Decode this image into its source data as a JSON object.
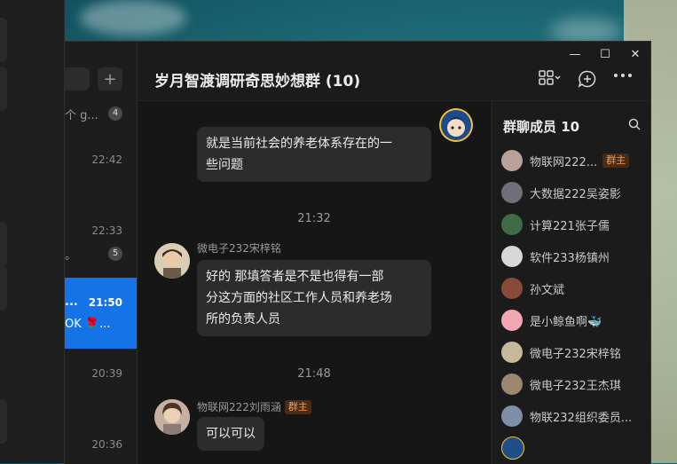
{
  "conversation_list": {
    "add_label": "+",
    "items": [
      {
        "time": "",
        "snippet": "个 g...",
        "badge": "4"
      },
      {
        "time": "22:42",
        "snippet": "",
        "badge": ""
      },
      {
        "time": "22:33",
        "snippet": "。",
        "badge": "5"
      },
      {
        "time": "21:50",
        "snippet": "OK 🌹...",
        "prefix": "...",
        "badge": ""
      },
      {
        "time": "20:39",
        "snippet": "",
        "badge": ""
      },
      {
        "time": "20:36",
        "snippet": "",
        "badge": ""
      }
    ]
  },
  "window_controls": {
    "minimize": "—",
    "maximize": "☐",
    "close": "✕"
  },
  "chat": {
    "title": "岁月智渡调研奇思妙想群 (10)",
    "messages": [
      {
        "id": "m1",
        "own": true,
        "text_lines": [
          "就是当前社会的养老体系存在的一",
          "些问题"
        ]
      },
      {
        "id": "t1",
        "timestamp": "21:32"
      },
      {
        "id": "m2",
        "sender": "微电子232宋梓铭",
        "text_lines": [
          "好的 那填答者是不是也得有一部",
          "分这方面的社区工作人员和养老场",
          "所的负责人员"
        ]
      },
      {
        "id": "t2",
        "timestamp": "21:48"
      },
      {
        "id": "m3",
        "sender": "物联网222刘雨涵",
        "owner_badge": "群主",
        "text_lines": [
          "可以可以"
        ]
      }
    ]
  },
  "members": {
    "title": "群聊成员",
    "count": "10",
    "list": [
      {
        "name": "物联网222...",
        "badge": "群主",
        "color": "#b9a29a"
      },
      {
        "name": "大数据222吴姿影",
        "color": "#6f6f7a"
      },
      {
        "name": "计算221张子儒",
        "color": "#3f6b45"
      },
      {
        "name": "软件233杨镇州",
        "color": "#d8d8d8"
      },
      {
        "name": "孙文斌",
        "color": "#8a4a3a"
      },
      {
        "name": "是小鲸鱼啊🐳",
        "color": "#f3a7b5"
      },
      {
        "name": "微电子232宋梓铭",
        "color": "#c7b89a"
      },
      {
        "name": "微电子232王杰琪",
        "color": "#9c8670"
      },
      {
        "name": "物联232组织委员...",
        "color": "#7e8fa8"
      },
      {
        "name": "",
        "color": "#1f4e8a"
      }
    ]
  },
  "colors": {
    "accent": "#1473e6",
    "owner_badge": "#ff9a4d"
  }
}
